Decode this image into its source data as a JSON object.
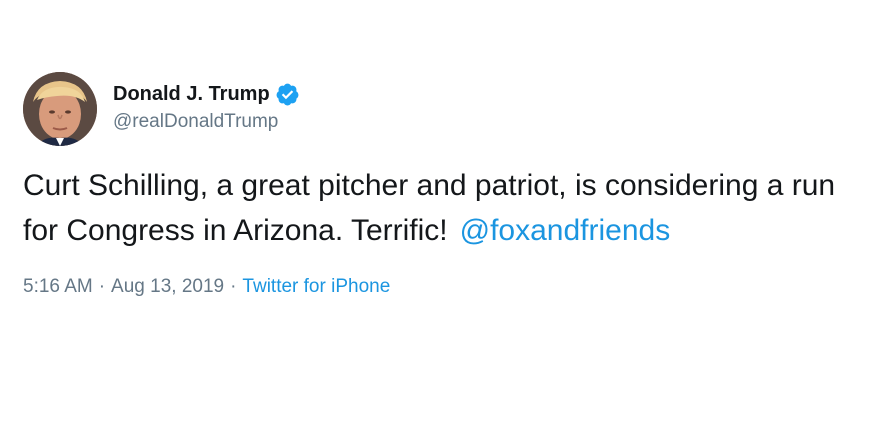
{
  "user": {
    "display_name": "Donald J. Trump",
    "handle": "@realDonaldTrump",
    "verified": true,
    "verified_icon": "verified-badge-icon",
    "avatar_icon": "profile-photo"
  },
  "tweet": {
    "text": "Curt Schilling, a great pitcher and patriot, is considering a run for Congress in Arizona. Terrific!",
    "mention": "@foxandfriends"
  },
  "meta": {
    "time": "5:16 AM",
    "separator": "·",
    "date": "Aug 13, 2019",
    "source": "Twitter for iPhone"
  },
  "colors": {
    "link": "#1b95e0",
    "secondary_text": "#657786",
    "primary_text": "#14171a",
    "verified_badge": "#1da1f2"
  }
}
